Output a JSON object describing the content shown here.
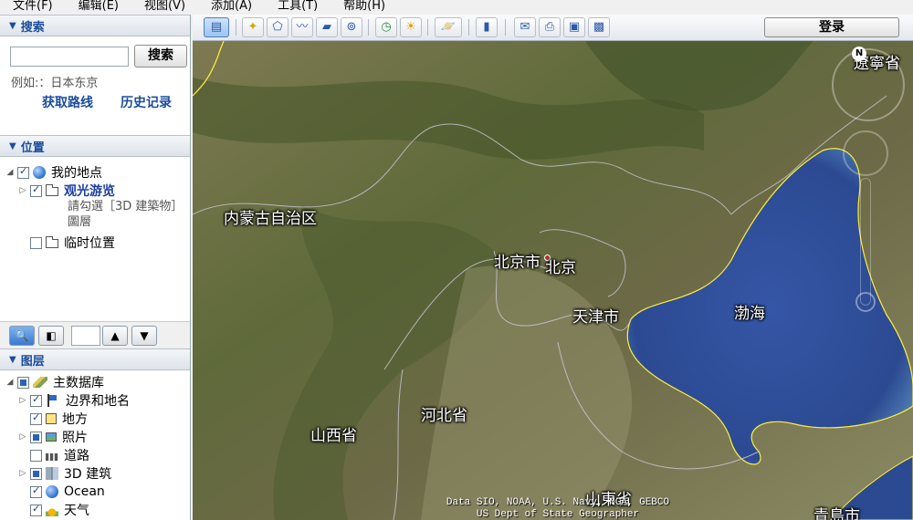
{
  "menu": [
    "文件(F)",
    "编辑(E)",
    "视图(V)",
    "添加(A)",
    "工具(T)",
    "帮助(H)"
  ],
  "search": {
    "header": "搜索",
    "input_value": "",
    "button_label": "搜索",
    "example": "例如:：日本东京",
    "directions_label": "获取路线",
    "history_label": "历史记录"
  },
  "places": {
    "header": "位置",
    "my_places": "我的地点",
    "sightseeing": "观光游览",
    "note": "請勾選［3D 建築物］圖層",
    "temp_places": "临时位置"
  },
  "layers": {
    "header": "图层",
    "items": [
      "主数据库",
      "边界和地名",
      "地方",
      "照片",
      "道路",
      "3D 建筑",
      "Ocean",
      "天气"
    ]
  },
  "toolbar": {
    "login_label": "登录"
  },
  "map": {
    "labels": [
      "内蒙古自治区",
      "北京市",
      "北京",
      "天津市",
      "渤海",
      "河北省",
      "山西省",
      "山東省",
      "遼寧省",
      "青島市"
    ],
    "attribution_line1": "Data SIO, NOAA, U.S. Navy, NGA, GEBCO",
    "attribution_line2": "US Dept of State Geographer",
    "compass_n": "N"
  },
  "colors": {
    "accent": "#1b4d9c",
    "sea": "#2f4f9a",
    "land": "#6b6d45",
    "coast": "#ffef3a"
  }
}
